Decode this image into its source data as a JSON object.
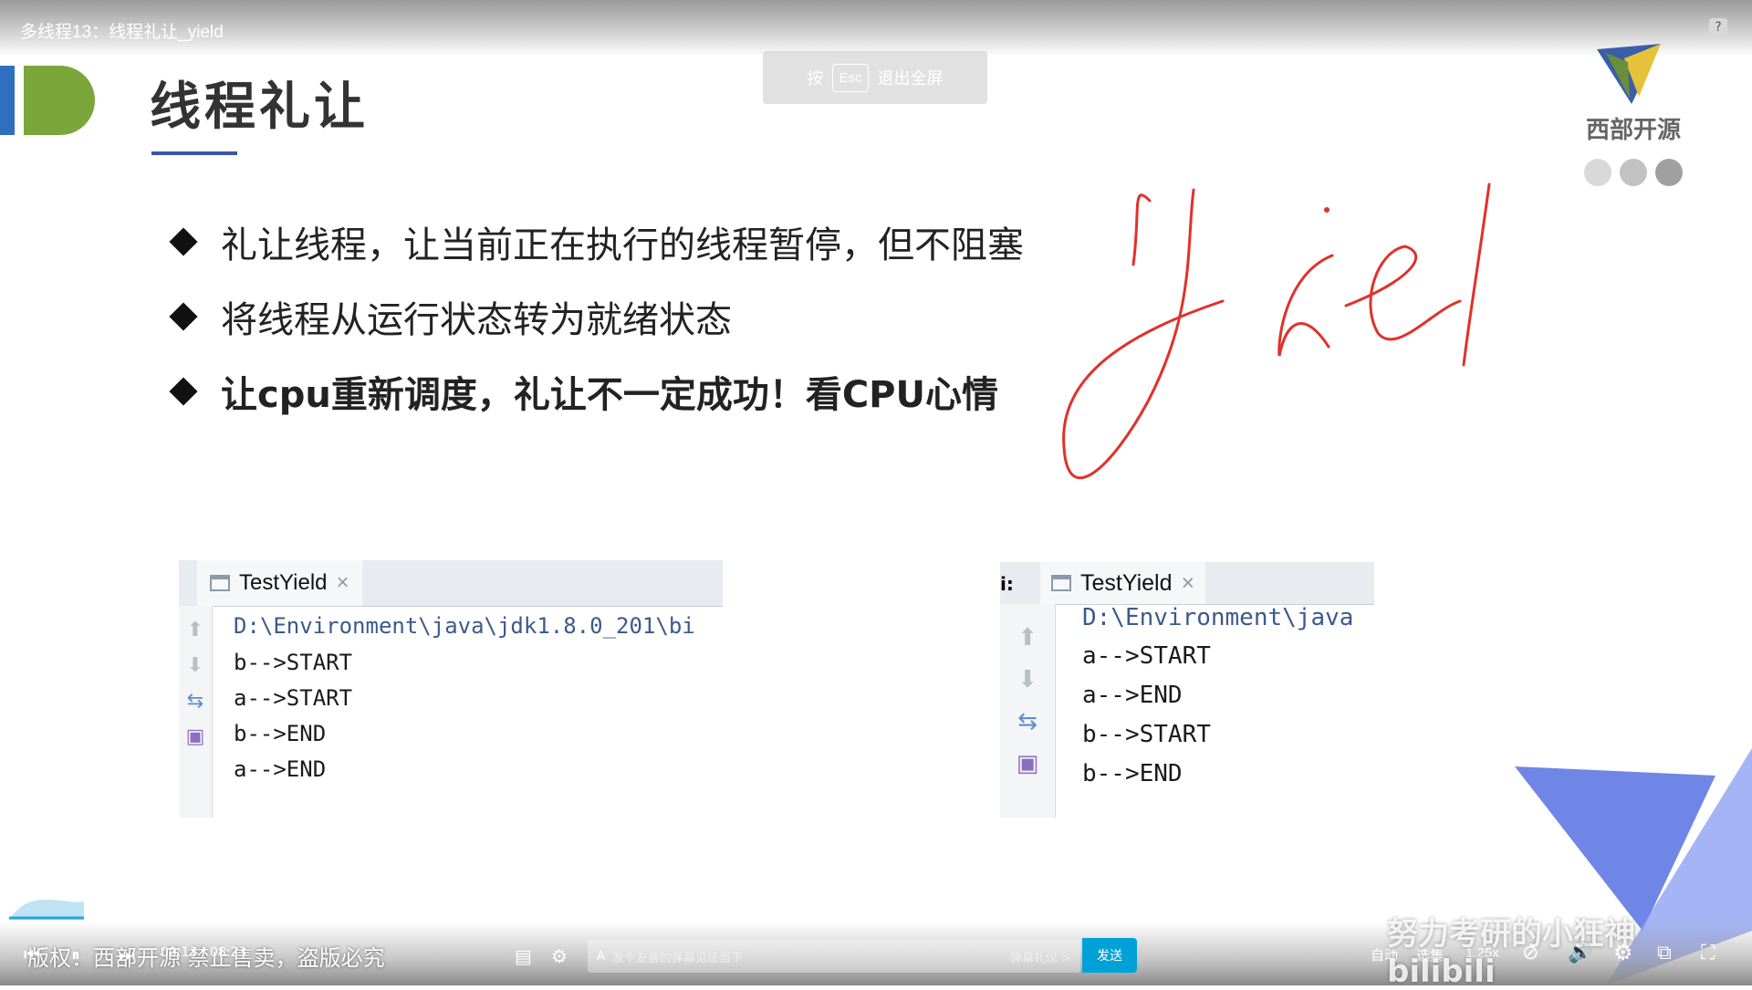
{
  "top_bar": {
    "title": "多线程13：线程礼让_yield",
    "help": "?"
  },
  "esc_hint": {
    "press": "按",
    "key": "Esc",
    "action": "退出全屏"
  },
  "slide": {
    "title": "线程礼让",
    "brand": "西部开源",
    "bullets": [
      "礼让线程，让当前正在执行的线程暂停，但不阻塞",
      "将线程从运行状态转为就绪状态",
      "让cpu重新调度，礼让不一定成功！看CPU心情"
    ],
    "handwriting": "yiel"
  },
  "console_left": {
    "tab": "TestYield",
    "close": "×",
    "lines": [
      "D:\\Environment\\java\\jdk1.8.0_201\\bi",
      "b-->START",
      "a-->START",
      "b-->END",
      "a-->END"
    ]
  },
  "console_right": {
    "prefix": "i:",
    "tab": "TestYield",
    "close": "×",
    "lines": [
      "D:\\Environment\\java",
      "a-->START",
      "a-->END",
      "b-->START",
      "b-->END"
    ]
  },
  "player": {
    "copyright": "版权：西部开源 禁止售卖，盗版必究",
    "time": "00:13 / 08:23",
    "danmaku_placeholder": "发个友善的弹幕见证当下",
    "danmaku_etiquette": "弹幕礼仪 >",
    "send": "发送",
    "quality": "自动",
    "episodes": "选集",
    "speed": "1.25x",
    "watermark": "努力考研的小狂神 bilibili"
  },
  "colors": {
    "accent": "#00a1d6",
    "title_underline": "#3b55a8",
    "handwriting": "#e0312b"
  }
}
